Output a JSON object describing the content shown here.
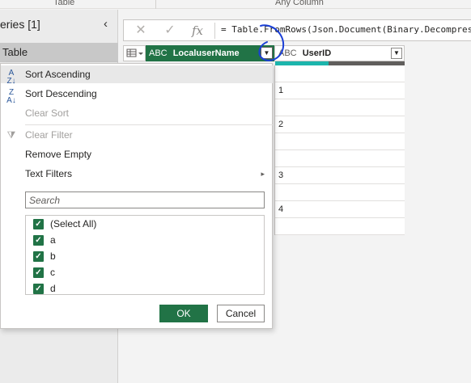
{
  "ribbon": {
    "groups": [
      "Table",
      "Any Column"
    ]
  },
  "queries_pane": {
    "title": "eries [1]",
    "collapse_icon": "chevron-left-icon",
    "selected_query": "Table"
  },
  "formula_bar": {
    "cancel_icon": "close-icon",
    "confirm_icon": "check-icon",
    "fx_label": "fx",
    "formula": "= Table.FromRows(Json.Document(Binary.Decompress("
  },
  "grid": {
    "columns": [
      {
        "name": "LocaluserName",
        "type_icon": "ABC",
        "selected": true,
        "accent": "#217346"
      },
      {
        "name": "UserID",
        "type_icon": "ABC",
        "selected": false
      }
    ],
    "userid_values": [
      "",
      "1",
      "",
      "2",
      "",
      "",
      "3",
      "",
      "4",
      ""
    ],
    "quality_colors": {
      "valid": "#1cb5ac",
      "empty": "#605e5c"
    }
  },
  "filter_menu": {
    "items": [
      {
        "label": "Sort Ascending",
        "icon": "sort-ascending-icon",
        "disabled": false,
        "hover": true
      },
      {
        "label": "Sort Descending",
        "icon": "sort-descending-icon",
        "disabled": false
      },
      {
        "label": "Clear Sort",
        "disabled": true
      },
      {
        "label": "Clear Filter",
        "icon": "clear-filter-icon",
        "disabled": true
      },
      {
        "label": "Remove Empty",
        "disabled": false
      },
      {
        "label": "Text Filters",
        "disabled": false,
        "submenu": true
      }
    ],
    "search_placeholder": "Search",
    "values": [
      {
        "label": "(Select All)",
        "checked": true
      },
      {
        "label": "a",
        "checked": true
      },
      {
        "label": "b",
        "checked": true
      },
      {
        "label": "c",
        "checked": true
      },
      {
        "label": "d",
        "checked": true
      }
    ],
    "ok_label": "OK",
    "cancel_label": "Cancel"
  },
  "colors": {
    "accent_green": "#217346",
    "annotation_blue": "#1a3fd6"
  }
}
